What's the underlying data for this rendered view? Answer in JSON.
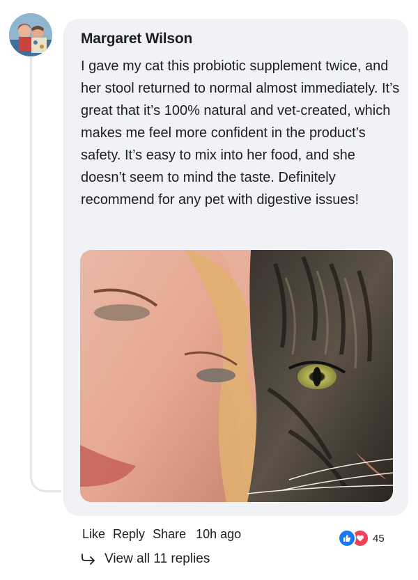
{
  "comment": {
    "author": "Margaret Wilson",
    "text": "I gave my cat this probiotic supplement twice, and her stool returned to normal almost immediately. It’s great that it’s 100% natural and vet-created, which makes me feel more confident in the product’s safety. It’s easy to mix into her food, and she doesn’t seem to mind the taste. Definitely recommend for any pet with digestive issues!",
    "photo": "woman-and-tabby-cat-selfie"
  },
  "actions": {
    "like": "Like",
    "reply": "Reply",
    "share": "Share",
    "time": "10h ago"
  },
  "reactions": {
    "icons": [
      "thumbs-up-icon",
      "heart-icon"
    ],
    "count": "45",
    "like_color": "#1877f2",
    "love_color": "#f33e58"
  },
  "replies": {
    "label": "View all 11 replies",
    "icon": "reply-arrow-icon"
  }
}
